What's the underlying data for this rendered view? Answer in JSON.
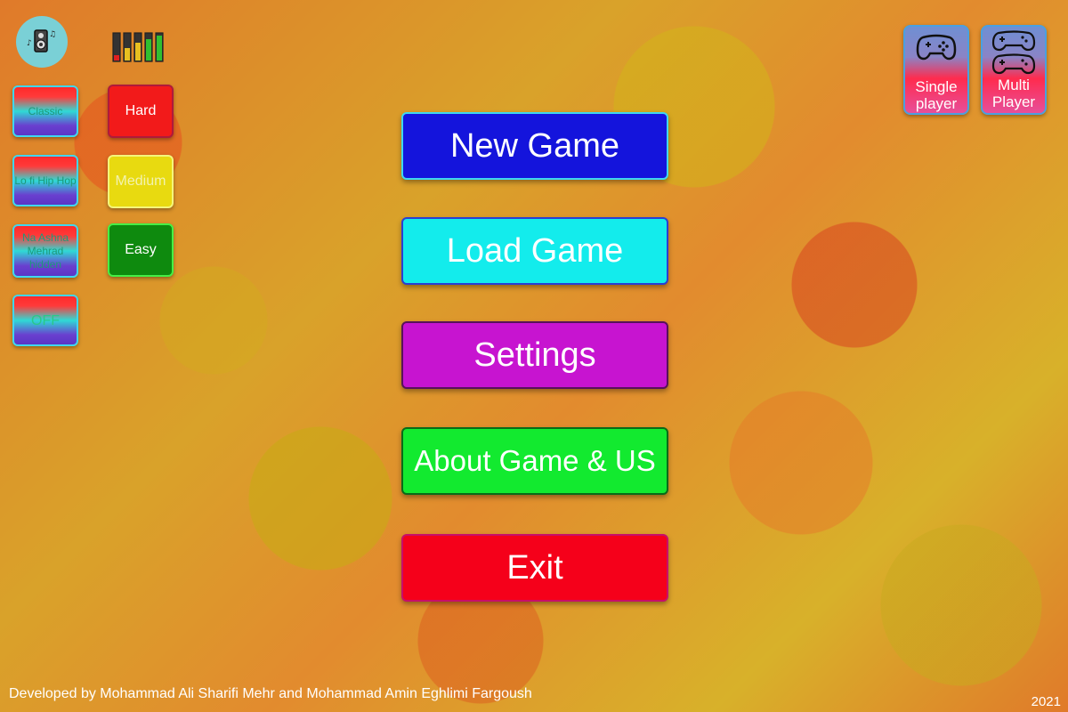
{
  "top_left": {
    "speaker_icon": "speaker-music-icon",
    "equalizer_icon": "equalizer-icon"
  },
  "music_buttons": [
    {
      "label": "Classic"
    },
    {
      "label": "Lo fi Hip Hop"
    },
    {
      "label": "Na Ashna Mehrad hidden"
    },
    {
      "label": "OFF"
    }
  ],
  "difficulty_buttons": [
    {
      "label": "Hard",
      "color": "#f21a1a"
    },
    {
      "label": "Medium",
      "color": "#e8da10"
    },
    {
      "label": "Easy",
      "color": "#0e8a0e"
    }
  ],
  "mode_buttons": [
    {
      "label": "Single player",
      "icon": "gamepad-icon"
    },
    {
      "label": "Multi Player",
      "icon": "two-gamepads-icon"
    }
  ],
  "main_menu": {
    "new_game": "New Game",
    "load_game": "Load Game",
    "settings": "Settings",
    "about": "About Game & US",
    "exit": "Exit"
  },
  "footer": {
    "credits": "Developed by Mohammad Ali Sharifi Mehr and Mohammad Amin Eghlimi Fargoush",
    "year": "2021"
  }
}
